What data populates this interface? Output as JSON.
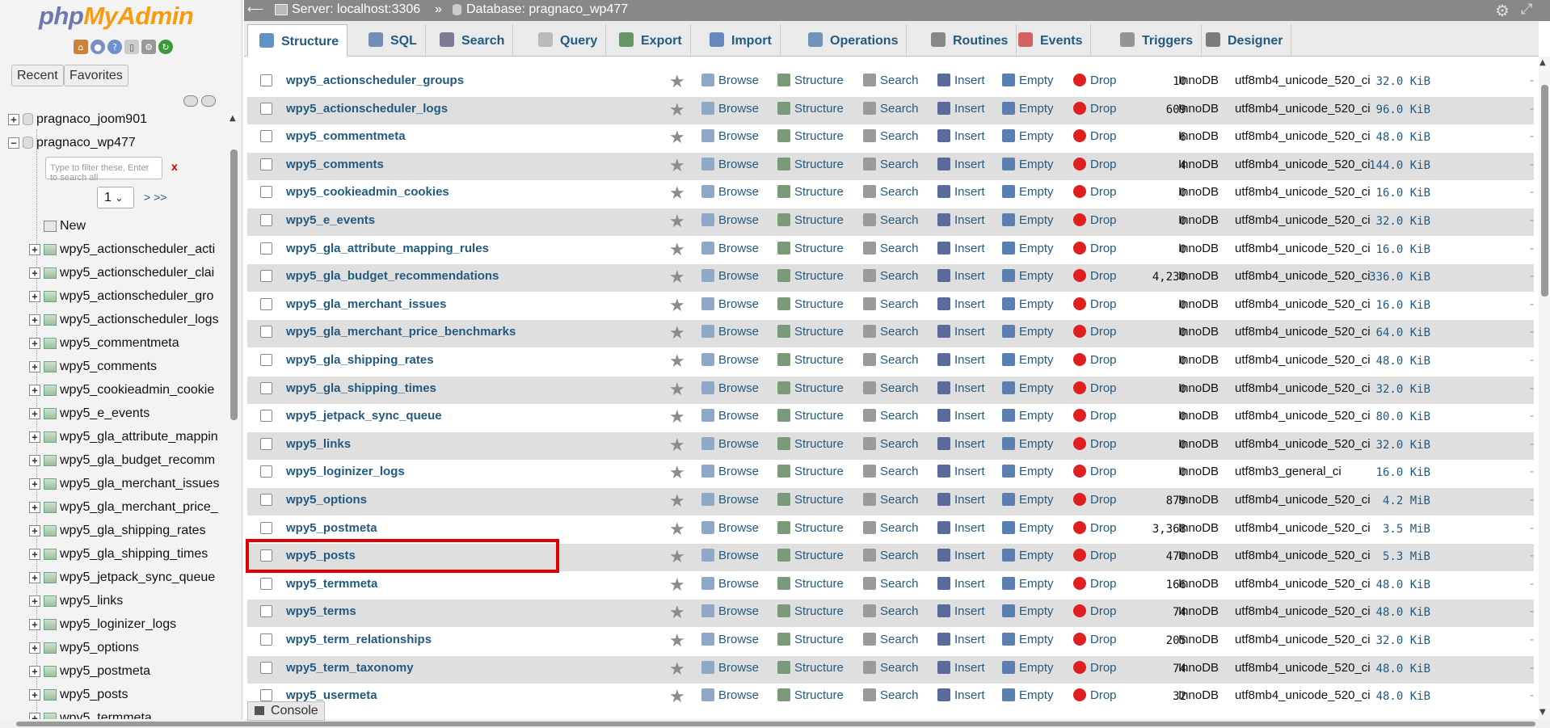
{
  "logo": {
    "php": "php",
    "myadmin": "MyAdmin"
  },
  "logo_icons": [
    "home-icon",
    "logout-icon",
    "help-icon",
    "docs-icon",
    "settings-icon",
    "reload-icon"
  ],
  "nav": {
    "recent": "Recent",
    "favorites": "Favorites"
  },
  "tree": {
    "databases": [
      "pragnaco_joom901",
      "pragnaco_wp477"
    ],
    "filter_placeholder": "Type to filter these, Enter to search all",
    "filter_clear": "x",
    "page_value": "1",
    "page_next": "> >>",
    "new_label": "New",
    "tables": [
      "wpy5_actionscheduler_acti",
      "wpy5_actionscheduler_clai",
      "wpy5_actionscheduler_gro",
      "wpy5_actionscheduler_logs",
      "wpy5_commentmeta",
      "wpy5_comments",
      "wpy5_cookieadmin_cookie",
      "wpy5_e_events",
      "wpy5_gla_attribute_mappin",
      "wpy5_gla_budget_recomm",
      "wpy5_gla_merchant_issues",
      "wpy5_gla_merchant_price_",
      "wpy5_gla_shipping_rates",
      "wpy5_gla_shipping_times",
      "wpy5_jetpack_sync_queue",
      "wpy5_links",
      "wpy5_loginizer_logs",
      "wpy5_options",
      "wpy5_postmeta",
      "wpy5_posts",
      "wpy5_termmeta"
    ]
  },
  "breadcrumb": {
    "server": "Server: localhost:3306",
    "sep": "»",
    "database": "Database: pragnaco_wp477"
  },
  "tabs": [
    "Structure",
    "SQL",
    "Search",
    "Query",
    "Export",
    "Import",
    "Operations",
    "Routines",
    "Events",
    "Triggers",
    "Designer"
  ],
  "actions": {
    "browse": "Browse",
    "structure": "Structure",
    "search": "Search",
    "insert": "Insert",
    "empty": "Empty",
    "drop": "Drop"
  },
  "rows": [
    {
      "name": "wpy5_actionscheduler_groups",
      "rows": "10",
      "engine": "InnoDB",
      "collation": "utf8mb4_unicode_520_ci",
      "size": "32.0 KiB"
    },
    {
      "name": "wpy5_actionscheduler_logs",
      "rows": "609",
      "engine": "InnoDB",
      "collation": "utf8mb4_unicode_520_ci",
      "size": "96.0 KiB"
    },
    {
      "name": "wpy5_commentmeta",
      "rows": "6",
      "engine": "InnoDB",
      "collation": "utf8mb4_unicode_520_ci",
      "size": "48.0 KiB"
    },
    {
      "name": "wpy5_comments",
      "rows": "4",
      "engine": "InnoDB",
      "collation": "utf8mb4_unicode_520_ci",
      "size": "144.0 KiB"
    },
    {
      "name": "wpy5_cookieadmin_cookies",
      "rows": "0",
      "engine": "InnoDB",
      "collation": "utf8mb4_unicode_520_ci",
      "size": "16.0 KiB"
    },
    {
      "name": "wpy5_e_events",
      "rows": "0",
      "engine": "InnoDB",
      "collation": "utf8mb4_unicode_520_ci",
      "size": "32.0 KiB"
    },
    {
      "name": "wpy5_gla_attribute_mapping_rules",
      "rows": "0",
      "engine": "InnoDB",
      "collation": "utf8mb4_unicode_520_ci",
      "size": "16.0 KiB"
    },
    {
      "name": "wpy5_gla_budget_recommendations",
      "rows": "4,230",
      "engine": "InnoDB",
      "collation": "utf8mb4_unicode_520_ci",
      "size": "336.0 KiB"
    },
    {
      "name": "wpy5_gla_merchant_issues",
      "rows": "0",
      "engine": "InnoDB",
      "collation": "utf8mb4_unicode_520_ci",
      "size": "16.0 KiB"
    },
    {
      "name": "wpy5_gla_merchant_price_benchmarks",
      "rows": "0",
      "engine": "InnoDB",
      "collation": "utf8mb4_unicode_520_ci",
      "size": "64.0 KiB"
    },
    {
      "name": "wpy5_gla_shipping_rates",
      "rows": "0",
      "engine": "InnoDB",
      "collation": "utf8mb4_unicode_520_ci",
      "size": "48.0 KiB"
    },
    {
      "name": "wpy5_gla_shipping_times",
      "rows": "0",
      "engine": "InnoDB",
      "collation": "utf8mb4_unicode_520_ci",
      "size": "32.0 KiB"
    },
    {
      "name": "wpy5_jetpack_sync_queue",
      "rows": "0",
      "engine": "InnoDB",
      "collation": "utf8mb4_unicode_520_ci",
      "size": "80.0 KiB"
    },
    {
      "name": "wpy5_links",
      "rows": "0",
      "engine": "InnoDB",
      "collation": "utf8mb4_unicode_520_ci",
      "size": "32.0 KiB"
    },
    {
      "name": "wpy5_loginizer_logs",
      "rows": "0",
      "engine": "InnoDB",
      "collation": "utf8mb3_general_ci",
      "size": "16.0 KiB"
    },
    {
      "name": "wpy5_options",
      "rows": "879",
      "engine": "InnoDB",
      "collation": "utf8mb4_unicode_520_ci",
      "size": "4.2 MiB"
    },
    {
      "name": "wpy5_postmeta",
      "rows": "3,368",
      "engine": "InnoDB",
      "collation": "utf8mb4_unicode_520_ci",
      "size": "3.5 MiB"
    },
    {
      "name": "wpy5_posts",
      "rows": "470",
      "engine": "InnoDB",
      "collation": "utf8mb4_unicode_520_ci",
      "size": "5.3 MiB"
    },
    {
      "name": "wpy5_termmeta",
      "rows": "166",
      "engine": "InnoDB",
      "collation": "utf8mb4_unicode_520_ci",
      "size": "48.0 KiB"
    },
    {
      "name": "wpy5_terms",
      "rows": "74",
      "engine": "InnoDB",
      "collation": "utf8mb4_unicode_520_ci",
      "size": "48.0 KiB"
    },
    {
      "name": "wpy5_term_relationships",
      "rows": "205",
      "engine": "InnoDB",
      "collation": "utf8mb4_unicode_520_ci",
      "size": "32.0 KiB"
    },
    {
      "name": "wpy5_term_taxonomy",
      "rows": "74",
      "engine": "InnoDB",
      "collation": "utf8mb4_unicode_520_ci",
      "size": "48.0 KiB"
    },
    {
      "name": "wpy5_usermeta",
      "rows": "32",
      "engine": "InnoDB",
      "collation": "utf8mb4_unicode_520_ci",
      "size": "48.0 KiB"
    }
  ],
  "highlighted_row": "wpy5_posts",
  "console": "Console",
  "colors": {
    "link": "#235a81",
    "highlight": "#e00000",
    "drop": "#e02020",
    "topbar": "#888888"
  }
}
